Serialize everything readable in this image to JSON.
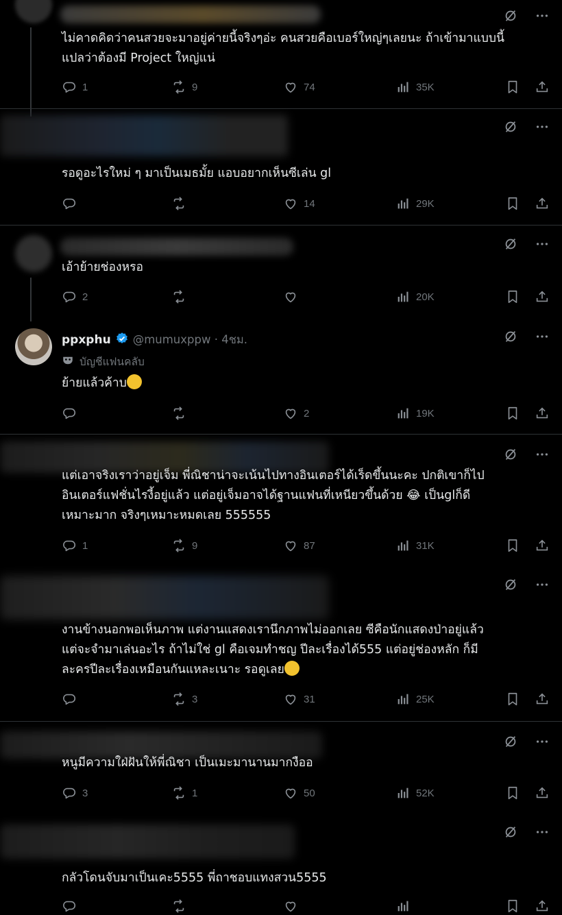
{
  "posts": [
    {
      "text": "ไม่คาดคิดว่าคนสวยจะมาอยู่ค่ายนี้จริงๆอ่ะ คนสวยคือเบอร์ใหญ่ๆเลยนะ ถ้าเข้ามาแบบนี้\nแปลว่าต้องมี Project ใหญ่แน่",
      "replies": "1",
      "reposts": "9",
      "likes": "74",
      "views": "35K"
    },
    {
      "text": "รอดูอะไรใหม่ ๆ มาเป็นเมธมั้ย แอบอยากเห็นซีเล่น gl",
      "replies": "",
      "reposts": "",
      "likes": "14",
      "views": "29K"
    },
    {
      "text": "เอ้าย้ายช่องหรอ",
      "replies": "2",
      "reposts": "",
      "likes": "",
      "views": "20K"
    },
    {
      "name": "ppxphu",
      "handle": "@mumuxppw · 4ชม.",
      "badge": "บัญชีแฟนคลับ",
      "text": "ย้ายแล้วค้าบ",
      "replies": "",
      "reposts": "",
      "likes": "2",
      "views": "19K"
    },
    {
      "text": "แต่เอาจริงเราว่าอยู่เจ็ม พี่ณิชาน่าจะเน้นไปทางอินเตอร์ได้เร็ดขึ้นนะคะ ปกติเขาก็ไป\nอินเตอร์แฟชั่นไรงี้อยู่แล้ว แต่อยู่เจ็มอาจได้ฐานแฟนที่เหนียวขึ้นด้วย 😂 เป็นglก็ดี\nเหมาะมาก จริงๆเหมาะหมดเลย 555555",
      "replies": "1",
      "reposts": "9",
      "likes": "87",
      "views": "31K"
    },
    {
      "text": "งานข้างนอกพอเห็นภาพ แต่งานแสดงเรานึกภาพไม่ออกเลย ซีคือนักแสดงป่าอยู่แล้ว\nแต่จะจำมาเล่นอะไร ถ้าไม่ใช่ gl คือเจมทำชญ ปีละเรื่องได้555 แต่อยู่ช่องหลัก ก็มี\nละครปีละเรื่องเหมือนกันแหละเนาะ รอดูเลย",
      "replies": "",
      "reposts": "3",
      "likes": "31",
      "views": "25K"
    },
    {
      "text": "หนูมีความใฝ่ฝันให้พี่ณิชา เป็นเมะมานานมากงืออ",
      "replies": "3",
      "reposts": "1",
      "likes": "50",
      "views": "52K"
    },
    {
      "text": "กลัวโดนจับมาเป็นเคะ5555 พี่ถาชอบแทงสวน5555",
      "replies": "",
      "reposts": "",
      "likes": "",
      "views": ""
    }
  ]
}
